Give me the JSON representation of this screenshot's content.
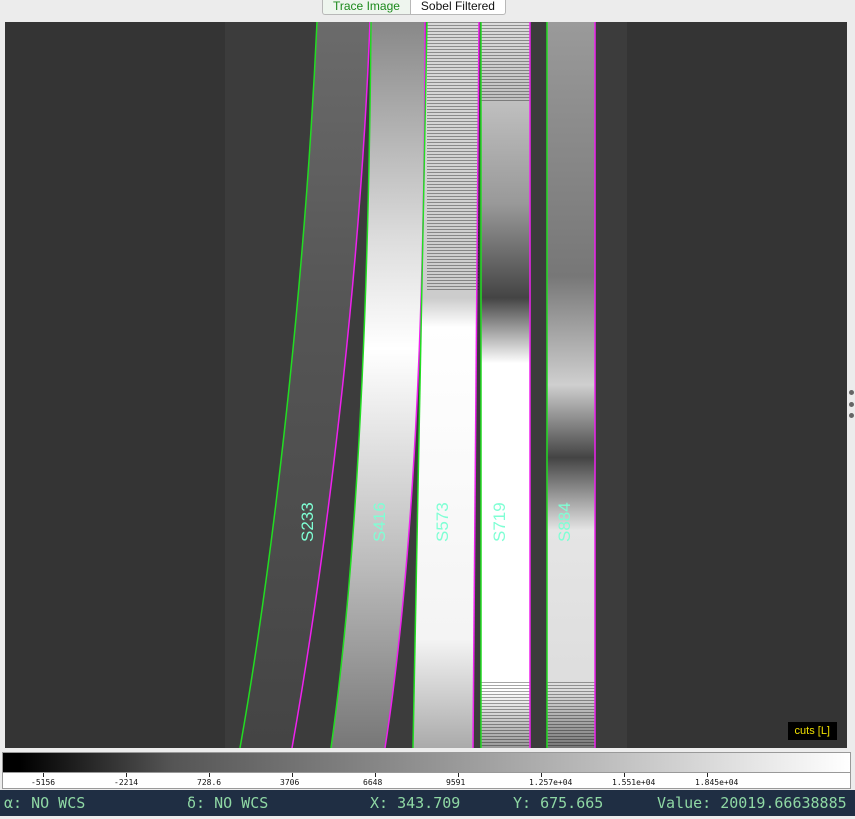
{
  "tabs": [
    {
      "label": "Trace Image",
      "active": true
    },
    {
      "label": "Sobel Filtered",
      "active": false
    }
  ],
  "viewer": {
    "slit_labels": [
      "S233",
      "S416",
      "S573",
      "S719",
      "S884"
    ],
    "cuts_label": "cuts [L]"
  },
  "colorbar": {
    "ticks": [
      "-5156",
      "-2214",
      "728.6",
      "3706",
      "6648",
      "9591",
      "1.257e+04",
      "1.551e+04",
      "1.845e+04"
    ]
  },
  "status": {
    "alpha": "α: NO WCS",
    "delta": "δ: NO WCS",
    "x": "X: 343.709",
    "y": "Y: 675.665",
    "value": "Value: 20019.66638885"
  },
  "colors": {
    "trace_green": "#22dd22",
    "trace_magenta": "#ee22ee",
    "label_cyan": "#7fffd4",
    "status_bg": "#1f2e43",
    "status_text": "#8fd8a4"
  }
}
